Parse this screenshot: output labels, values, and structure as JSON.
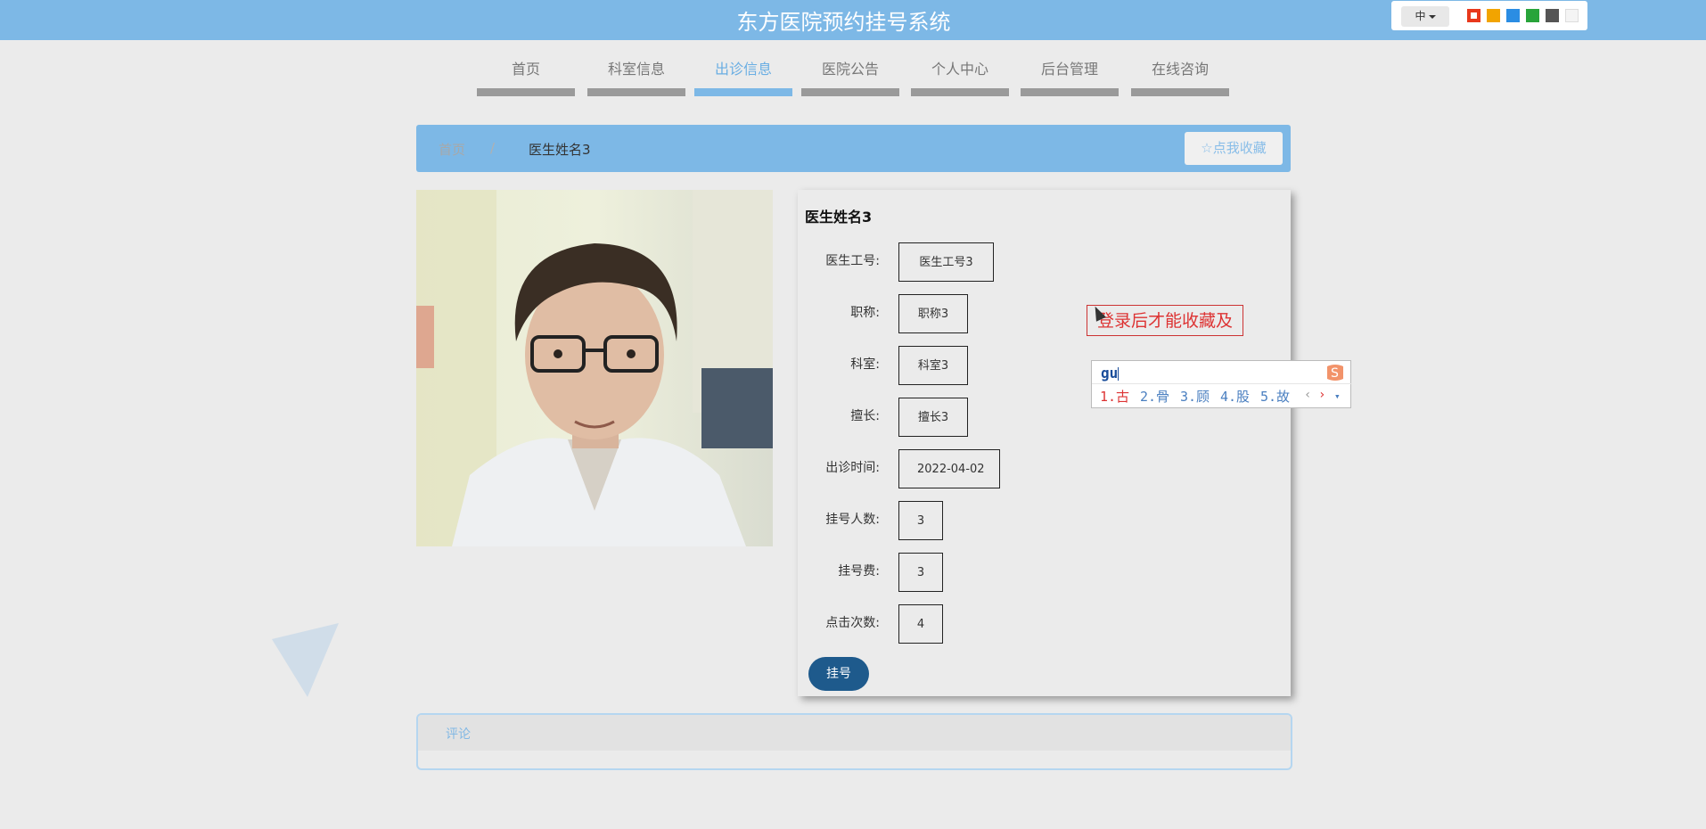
{
  "header": {
    "title": "东方医院预约挂号系统",
    "language": "中",
    "theme_colors": [
      "#e8381c",
      "#f2a400",
      "#2b8de3",
      "#28a43a",
      "#555555",
      "#f4f4f4"
    ]
  },
  "nav": {
    "items": [
      {
        "label": "首页"
      },
      {
        "label": "科室信息"
      },
      {
        "label": "出诊信息"
      },
      {
        "label": "医院公告"
      },
      {
        "label": "个人中心"
      },
      {
        "label": "后台管理"
      },
      {
        "label": "在线咨询"
      }
    ],
    "active": "出诊信息"
  },
  "breadcrumb": {
    "home": "首页",
    "separator": "/",
    "current": "医生姓名3",
    "favorite_button": "点我收藏"
  },
  "doctor": {
    "name": "医生姓名3",
    "fields": [
      {
        "label": "医生工号:",
        "value": "医生工号3"
      },
      {
        "label": "职称:",
        "value": "职称3"
      },
      {
        "label": "科室:",
        "value": "科室3"
      },
      {
        "label": "擅长:",
        "value": "擅长3"
      },
      {
        "label": "出诊时间:",
        "value": "2022-04-02"
      },
      {
        "label": "挂号人数:",
        "value": "3"
      },
      {
        "label": "挂号费:",
        "value": "3"
      },
      {
        "label": "点击次数:",
        "value": "4"
      }
    ],
    "register_button": "挂号"
  },
  "login_hint": "登录后才能收藏及",
  "comments": {
    "title": "评论"
  },
  "ime": {
    "input": "gu",
    "candidates": [
      "1.古",
      "2.骨",
      "3.顾",
      "4.股",
      "5.故"
    ]
  }
}
